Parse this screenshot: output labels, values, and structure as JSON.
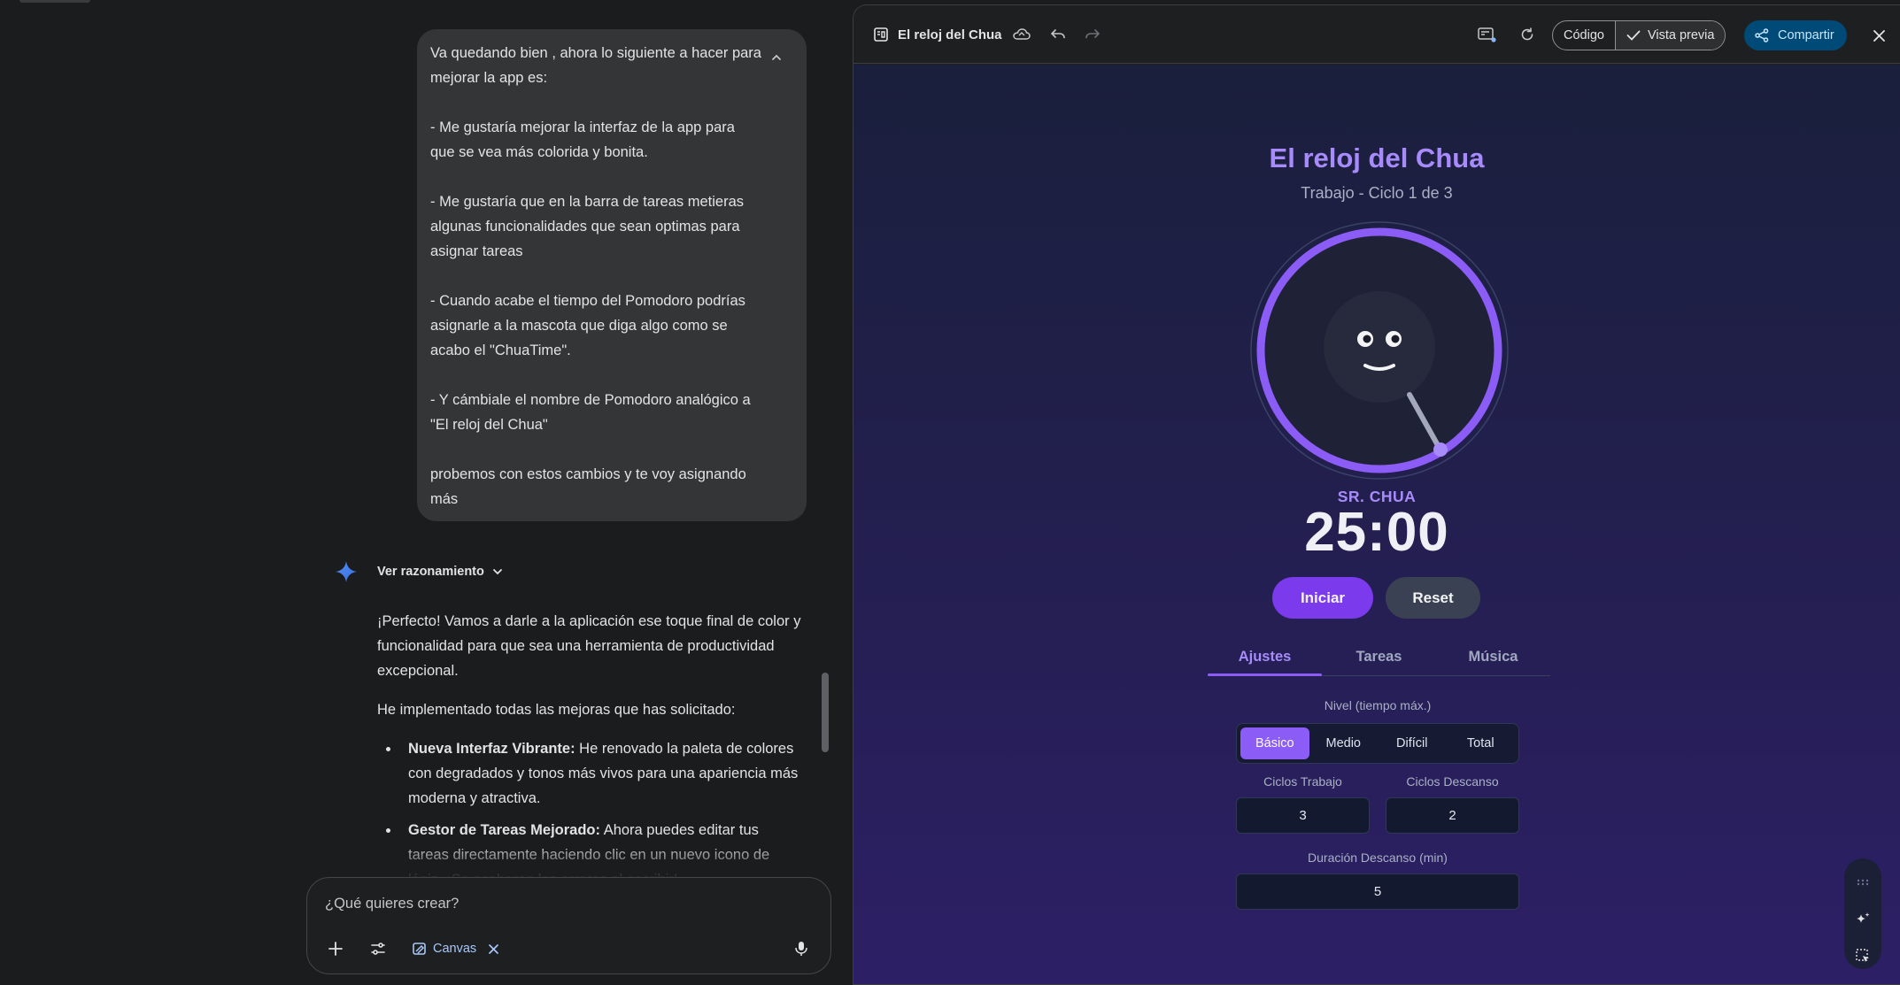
{
  "chat": {
    "user_message": "Va quedando bien , ahora lo siguiente a hacer para mejorar la app es:\n\n- Me gustaría mejorar la interfaz de la app para que se vea más colorida y bonita.\n\n- Me gustaría que en la barra de tareas metieras algunas funcionalidades que sean optimas para asignar tareas\n\n- Cuando acabe el tiempo del Pomodoro podrías asignarle a la mascota que diga algo como se acabo el \"ChuaTime\".\n\n- Y cámbiale el nombre de Pomodoro analógico a \"El reloj del Chua\"\n\nprobemos con estos cambios y te voy asignando más",
    "reasoning_label": "Ver razonamiento",
    "response": {
      "intro": "¡Perfecto! Vamos a darle a la aplicación ese toque final de color y funcionalidad para que sea una herramienta de productividad excepcional.",
      "lead": "He implementado todas las mejoras que has solicitado:",
      "bullets": [
        {
          "title": "Nueva Interfaz Vibrante:",
          "text": " He renovado la paleta de colores con degradados y tonos más vivos para una apariencia más moderna y atractiva."
        },
        {
          "title": "Gestor de Tareas Mejorado:",
          "text": " Ahora puedes editar tus tareas directamente haciendo clic en un nuevo icono de lápiz. ¡Se acabaron los errores al escribir!"
        }
      ]
    },
    "composer": {
      "placeholder": "¿Qué quieres crear?",
      "canvas_chip": "Canvas"
    }
  },
  "canvas": {
    "title": "El reloj del Chua",
    "code_label": "Código",
    "preview_label": "Vista previa",
    "share_label": "Compartir"
  },
  "app": {
    "title": "El reloj del Chua",
    "subtitle": "Trabajo - Ciclo 1 de 3",
    "mascot_name": "SR. CHUA",
    "timer": "25:00",
    "start_label": "Iniciar",
    "reset_label": "Reset",
    "tabs": [
      "Ajustes",
      "Tareas",
      "Música"
    ],
    "level_label": "Nivel (tiempo máx.)",
    "levels": [
      "Básico",
      "Medio",
      "Difícil",
      "Total"
    ],
    "selected_level": "Básico",
    "work_cycles_label": "Ciclos Trabajo",
    "work_cycles_value": "3",
    "rest_cycles_label": "Ciclos Descanso",
    "rest_cycles_value": "2",
    "rest_duration_label": "Duración Descanso (min)",
    "rest_duration_value": "5"
  },
  "colors": {
    "accent_purple": "#8b5cf6",
    "title_purple": "#a78bfa",
    "share_bg": "#004a77",
    "start_button": "#7c3aed"
  },
  "icons": [
    "chevron-up-icon",
    "gemini-spark-icon",
    "chevron-down-icon",
    "plus-icon",
    "tools-icon",
    "canvas-icon",
    "close-icon",
    "mic-icon",
    "document-icon",
    "cloud-icon",
    "undo-icon",
    "redo-icon",
    "console-icon",
    "refresh-icon",
    "check-icon",
    "share-icon"
  ]
}
